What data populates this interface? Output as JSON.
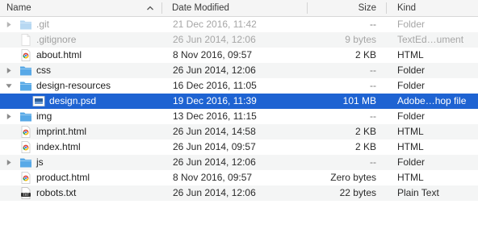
{
  "columns": {
    "name": "Name",
    "date_modified": "Date Modified",
    "size": "Size",
    "kind": "Kind"
  },
  "sort": {
    "column": "name",
    "direction": "ascending"
  },
  "colors": {
    "selection": "#1e63d2",
    "folder": "#58a9e6",
    "folder_dim": "#b7d8f2",
    "alt_row": "#f4f5f5"
  },
  "files": [
    {
      "name": ".git",
      "date": "21 Dec 2016, 11:42",
      "size": "--",
      "kind": "Folder",
      "type": "folder",
      "depth": 0,
      "disclosure": "collapsed",
      "dimmed": true,
      "selected": false,
      "icon": "folder-icon"
    },
    {
      "name": ".gitignore",
      "date": "26 Jun 2014, 12:06",
      "size": "9 bytes",
      "kind": "TextEd…ument",
      "type": "document",
      "depth": 0,
      "disclosure": "none",
      "dimmed": true,
      "selected": false,
      "icon": "blank-document-icon"
    },
    {
      "name": "about.html",
      "date": "8 Nov 2016, 09:57",
      "size": "2 KB",
      "kind": "HTML",
      "type": "html",
      "depth": 0,
      "disclosure": "none",
      "dimmed": false,
      "selected": false,
      "icon": "chrome-html-icon"
    },
    {
      "name": "css",
      "date": "26 Jun 2014, 12:06",
      "size": "--",
      "kind": "Folder",
      "type": "folder",
      "depth": 0,
      "disclosure": "collapsed",
      "dimmed": false,
      "selected": false,
      "icon": "folder-icon"
    },
    {
      "name": "design-resources",
      "date": "16 Dec 2016, 11:05",
      "size": "--",
      "kind": "Folder",
      "type": "folder",
      "depth": 0,
      "disclosure": "expanded",
      "dimmed": false,
      "selected": false,
      "icon": "folder-icon"
    },
    {
      "name": "design.psd",
      "date": "19 Dec 2016, 11:39",
      "size": "101 MB",
      "kind": "Adobe…hop file",
      "type": "psd",
      "depth": 1,
      "disclosure": "none",
      "dimmed": false,
      "selected": true,
      "icon": "photoshop-file-icon"
    },
    {
      "name": "img",
      "date": "13 Dec 2016, 11:15",
      "size": "--",
      "kind": "Folder",
      "type": "folder",
      "depth": 0,
      "disclosure": "collapsed",
      "dimmed": false,
      "selected": false,
      "icon": "folder-icon"
    },
    {
      "name": "imprint.html",
      "date": "26 Jun 2014, 14:58",
      "size": "2 KB",
      "kind": "HTML",
      "type": "html",
      "depth": 0,
      "disclosure": "none",
      "dimmed": false,
      "selected": false,
      "icon": "chrome-html-icon"
    },
    {
      "name": "index.html",
      "date": "26 Jun 2014, 09:57",
      "size": "2 KB",
      "kind": "HTML",
      "type": "html",
      "depth": 0,
      "disclosure": "none",
      "dimmed": false,
      "selected": false,
      "icon": "chrome-html-icon"
    },
    {
      "name": "js",
      "date": "26 Jun 2014, 12:06",
      "size": "--",
      "kind": "Folder",
      "type": "folder",
      "depth": 0,
      "disclosure": "collapsed",
      "dimmed": false,
      "selected": false,
      "icon": "folder-icon"
    },
    {
      "name": "product.html",
      "date": "8 Nov 2016, 09:57",
      "size": "Zero bytes",
      "kind": "HTML",
      "type": "html",
      "depth": 0,
      "disclosure": "none",
      "dimmed": false,
      "selected": false,
      "icon": "chrome-html-icon"
    },
    {
      "name": "robots.txt",
      "date": "26 Jun 2014, 12:06",
      "size": "22 bytes",
      "kind": "Plain Text",
      "type": "txt",
      "depth": 0,
      "disclosure": "none",
      "dimmed": false,
      "selected": false,
      "icon": "text-file-icon"
    }
  ]
}
